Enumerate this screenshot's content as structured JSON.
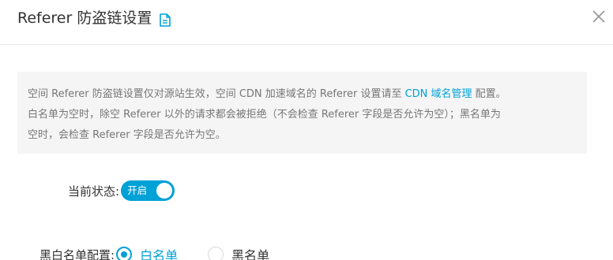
{
  "dialog": {
    "title": "Referer 防盗链设置",
    "doc_icon": "document-icon",
    "close_icon": "close-icon"
  },
  "notice": {
    "line1_prefix": "空间 Referer 防盗链设置仅对源站生效，空间 CDN 加速域名的 Referer 设置请至 ",
    "line1_link": "CDN 域名管理",
    "line1_suffix": " 配置。",
    "line2": "白名单为空时，除空 Referer 以外的请求都会被拒绝（不会检查 Referer 字段是否允许为空）；黑名单为",
    "line3": "空时，会检查 Referer 字段是否允许为空。"
  },
  "status": {
    "label": "当前状态:",
    "toggle_text": "开启",
    "toggle_on": true
  },
  "list_config": {
    "label": "黑白名单配置:",
    "options": [
      {
        "label": "白名单",
        "selected": true
      },
      {
        "label": "黑名单",
        "selected": false
      }
    ]
  },
  "colors": {
    "accent": "#00a1d6",
    "notice_bg": "#f5f5f6",
    "notice_text": "#777777",
    "text": "#333333"
  }
}
